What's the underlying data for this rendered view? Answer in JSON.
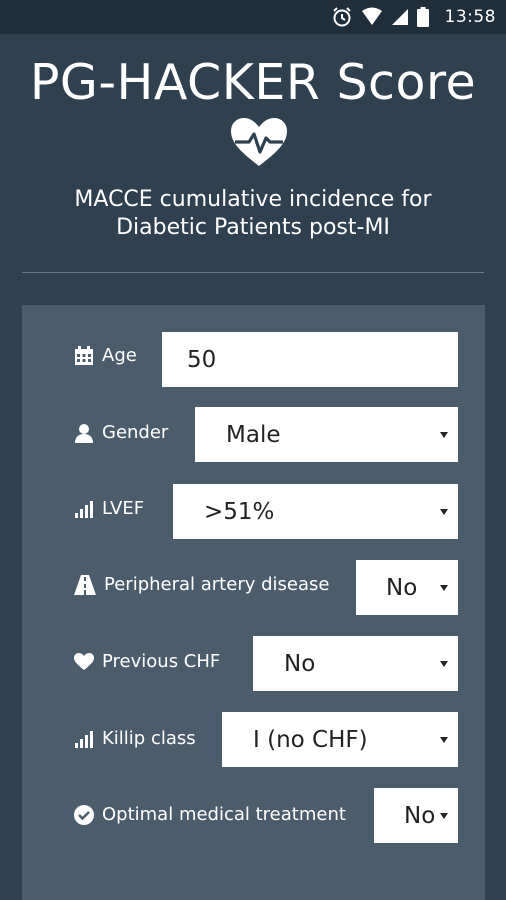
{
  "status": {
    "time": "13:58"
  },
  "app": {
    "title": "PG-HACKER Score",
    "subtitle_line1": "MACCE cumulative incidence for",
    "subtitle_line2": "Diabetic Patients post-MI"
  },
  "form": {
    "age": {
      "label": "Age",
      "value": "50"
    },
    "gender": {
      "label": "Gender",
      "value": "Male"
    },
    "lvef": {
      "label": "LVEF",
      "value": ">51%"
    },
    "pad": {
      "label": "Peripheral artery disease",
      "value": "No"
    },
    "chf": {
      "label": "Previous CHF",
      "value": "No"
    },
    "killip": {
      "label": "Killip class",
      "value": "I (no CHF)"
    },
    "omt": {
      "label": "Optimal medical treatment",
      "value": "No"
    }
  },
  "colors": {
    "background": "#2f4050",
    "panel": "#4b5d6d",
    "statusbar": "#1f2e3b"
  }
}
